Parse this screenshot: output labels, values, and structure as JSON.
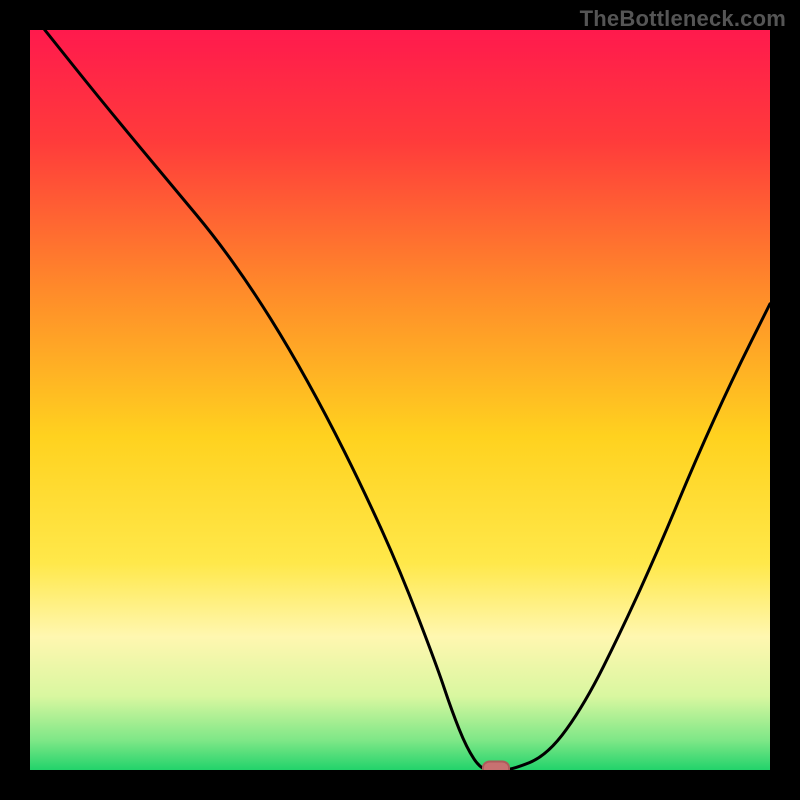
{
  "watermark": "TheBottleneck.com",
  "chart_data": {
    "type": "line",
    "title": "",
    "xlabel": "",
    "ylabel": "",
    "xlim": [
      0,
      100
    ],
    "ylim": [
      0,
      100
    ],
    "x": [
      2,
      10,
      20,
      25,
      30,
      35,
      40,
      45,
      50,
      55,
      57,
      59,
      61,
      63,
      65,
      70,
      75,
      80,
      85,
      90,
      95,
      100
    ],
    "y": [
      100,
      90,
      78,
      72,
      65,
      57,
      48,
      38,
      27,
      14,
      8,
      3,
      0,
      0,
      0,
      2,
      9,
      19,
      30,
      42,
      53,
      63
    ],
    "minimum_marker": {
      "x": 63,
      "y": 0
    },
    "background_gradient": {
      "stops": [
        {
          "pos": 0.0,
          "color": "#ff1a4d"
        },
        {
          "pos": 0.15,
          "color": "#ff3b3b"
        },
        {
          "pos": 0.35,
          "color": "#ff8a2a"
        },
        {
          "pos": 0.55,
          "color": "#ffd21f"
        },
        {
          "pos": 0.72,
          "color": "#ffe84a"
        },
        {
          "pos": 0.82,
          "color": "#fff7b0"
        },
        {
          "pos": 0.9,
          "color": "#d9f7a0"
        },
        {
          "pos": 0.96,
          "color": "#7ee787"
        },
        {
          "pos": 1.0,
          "color": "#22d36b"
        }
      ]
    }
  }
}
